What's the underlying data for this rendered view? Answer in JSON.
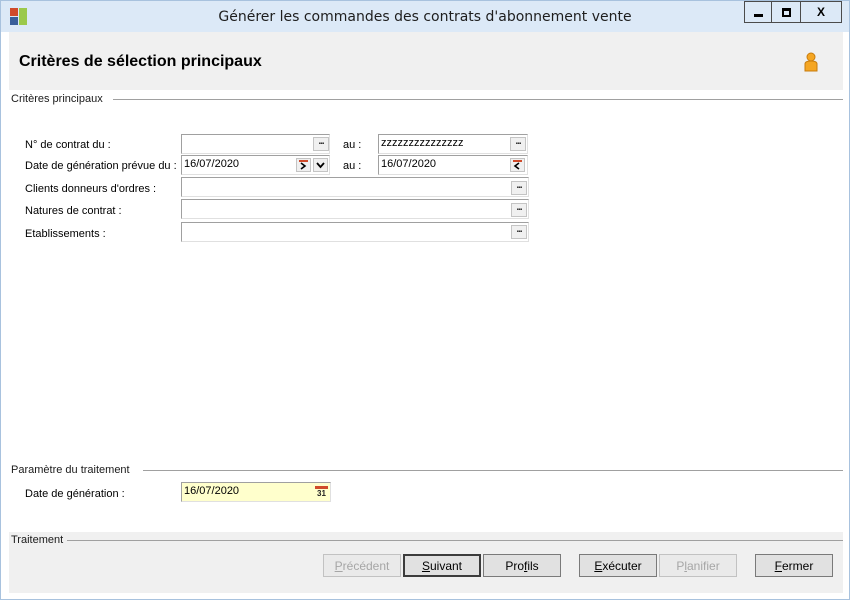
{
  "window": {
    "title": "Générer les commandes des contrats d'abonnement vente",
    "controls": {
      "minimize": "▬",
      "maximize": "☐",
      "close": "X"
    }
  },
  "header": {
    "title": "Critères de sélection principaux",
    "user_icon": "user-icon"
  },
  "criteria": {
    "group_title": "Critères principaux",
    "contract_from_label": "N° de contrat du :",
    "contract_from_value": "",
    "contract_to_label": "au :",
    "contract_to_value": "zzzzzzzzzzzzzzz",
    "gen_date_from_label": "Date de génération prévue du :",
    "gen_date_from_value": "16/07/2020",
    "gen_date_to_label": "au :",
    "gen_date_to_value": "16/07/2020",
    "clients_label": "Clients donneurs d'ordres  :",
    "clients_value": "",
    "natures_label": "Natures de contrat :",
    "natures_value": "",
    "etablissements_label": "Etablissements :",
    "etablissements_value": ""
  },
  "params": {
    "group_title": "Paramètre du traitement",
    "gen_date_label": "Date de génération :",
    "gen_date_value": "16/07/2020",
    "calendar_icon_text": "31"
  },
  "treatment": {
    "group_title": "Traitement",
    "buttons": {
      "previous": {
        "accel": "P",
        "rest": "récédent"
      },
      "next": {
        "accel": "S",
        "rest": "uivant"
      },
      "profiles": {
        "pre": "Pro",
        "accel": "f",
        "rest": "ils"
      },
      "execute": {
        "accel": "E",
        "rest": "xécuter"
      },
      "schedule": {
        "pre": "P",
        "accel": "l",
        "rest": "anifier"
      },
      "close": {
        "accel": "F",
        "rest": "ermer"
      }
    }
  },
  "colors": {
    "titlebar": "#dce9f7",
    "header_panel": "#f0f0f0",
    "required_field": "#ffffcc"
  }
}
